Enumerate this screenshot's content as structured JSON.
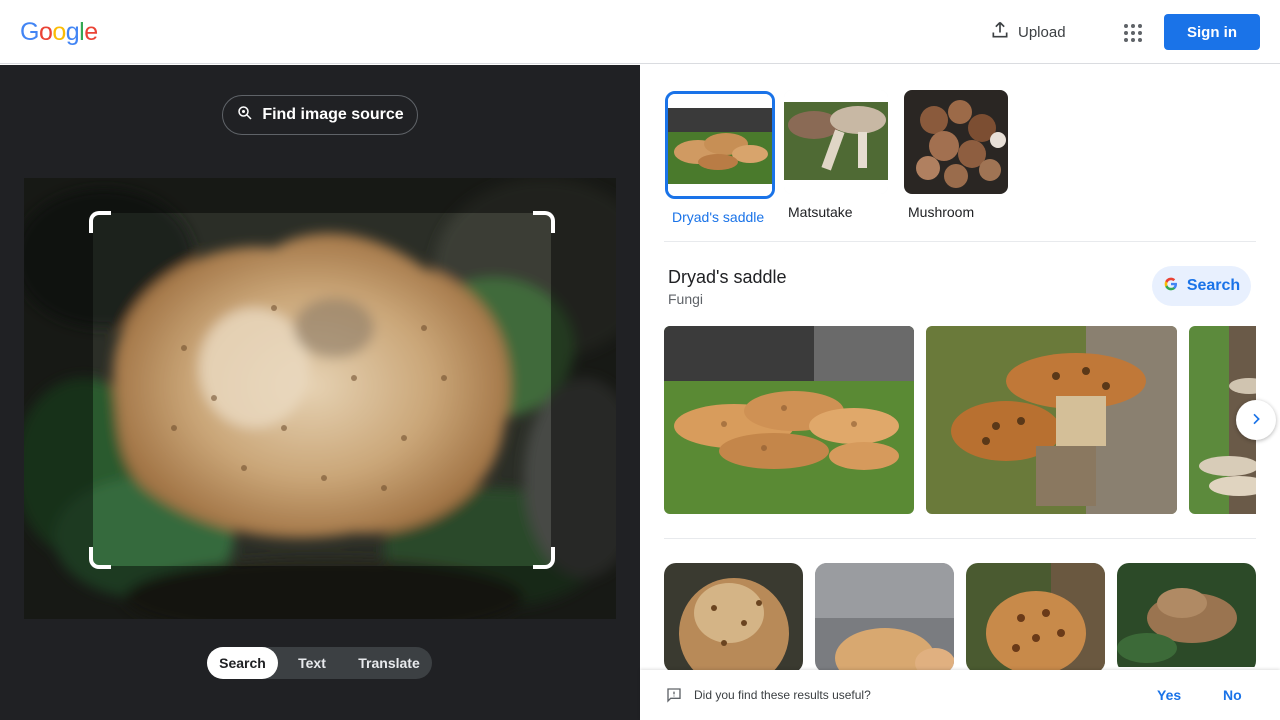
{
  "header": {
    "logo": [
      "G",
      "o",
      "o",
      "g",
      "l",
      "e"
    ],
    "logo_colors": [
      "#4285f4",
      "#ea4335",
      "#fbbc05",
      "#4285f4",
      "#34a853",
      "#ea4335"
    ],
    "upload_label": "Upload",
    "apps_icon": "apps-grid-icon",
    "signin_label": "Sign in"
  },
  "left_panel": {
    "find_source_label": "Find image source",
    "modes": [
      "Search",
      "Text",
      "Translate"
    ],
    "active_mode": "Search"
  },
  "right_panel": {
    "chips": [
      {
        "label": "Dryad's saddle",
        "selected": true
      },
      {
        "label": "Matsutake",
        "selected": false
      },
      {
        "label": "Mushroom",
        "selected": false
      }
    ],
    "knowledge": {
      "title": "Dryad's saddle",
      "subtitle": "Fungi",
      "search_label": "Search"
    },
    "feedback": {
      "question": "Did you find these results useful?",
      "yes": "Yes",
      "no": "No"
    }
  },
  "colors": {
    "accent": "#1a73e8",
    "dark_panel": "#202124"
  }
}
